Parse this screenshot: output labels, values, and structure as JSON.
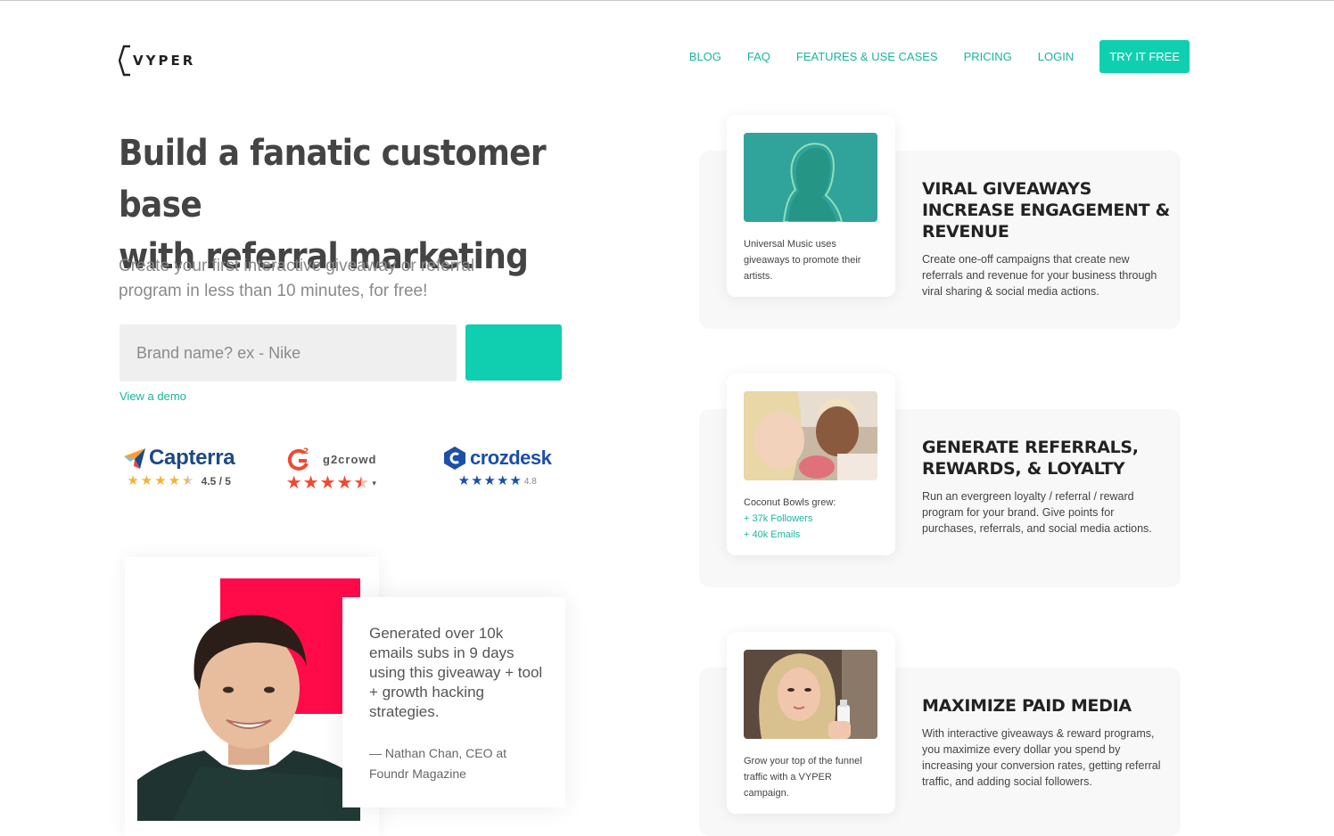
{
  "header": {
    "logo_text": "VYPER",
    "nav": [
      {
        "label": "BLOG"
      },
      {
        "label": "FAQ"
      },
      {
        "label": "FEATURES & USE CASES"
      },
      {
        "label": "PRICING"
      },
      {
        "label": "LOGIN"
      }
    ],
    "cta_label": "TRY IT FREE"
  },
  "hero": {
    "title_line1": "Build a fanatic customer base",
    "title_line2": "with referral marketing",
    "subtitle_line1": "Create your first interactive giveaway or referral",
    "subtitle_line2": "program in less than 10 minutes, for free!",
    "input_placeholder": "Brand name? ex - Nike",
    "demo_link": "View a demo"
  },
  "ratings": {
    "capterra": {
      "name": "Capterra",
      "score": "4.5 / 5",
      "stars": 4.5
    },
    "g2": {
      "name": "g2crowd",
      "stars": 4.5
    },
    "crozdesk": {
      "name": "crozdesk",
      "score": "4.8",
      "stars": 5
    }
  },
  "testimonial": {
    "quote": "Generated over 10k emails subs in 9 days using this giveaway + tool + growth hacking strategies.",
    "author_line1": "— Nathan Chan, CEO at",
    "author_line2": "Foundr Magazine"
  },
  "features": [
    {
      "caption": "Universal Music uses giveaways to promote their artists.",
      "title": "VIRAL GIVEAWAYS INCREASE ENGAGEMENT & REVENUE",
      "description": "Create one-off campaigns that create new referrals and revenue for your business through viral sharing & social media actions."
    },
    {
      "caption": "Coconut Bowls grew:",
      "stat1": "+ 37k Followers",
      "stat2": "+ 40k Emails",
      "title": "GENERATE REFERRALS, REWARDS, & LOYALTY",
      "description": "Run an evergreen loyalty / referral / reward program for your brand. Give points for purchases, referrals, and social media actions."
    },
    {
      "caption": "Grow your top of the funnel traffic with a VYPER campaign.",
      "title": "MAXIMIZE PAID MEDIA",
      "description": "With interactive giveaways & reward programs, you maximize every dollar you spend by increasing your conversion rates, getting referral traffic, and adding social followers."
    }
  ],
  "colors": {
    "accent": "#10cfb0",
    "link": "#19b59e",
    "red": "#ff0b4a"
  }
}
